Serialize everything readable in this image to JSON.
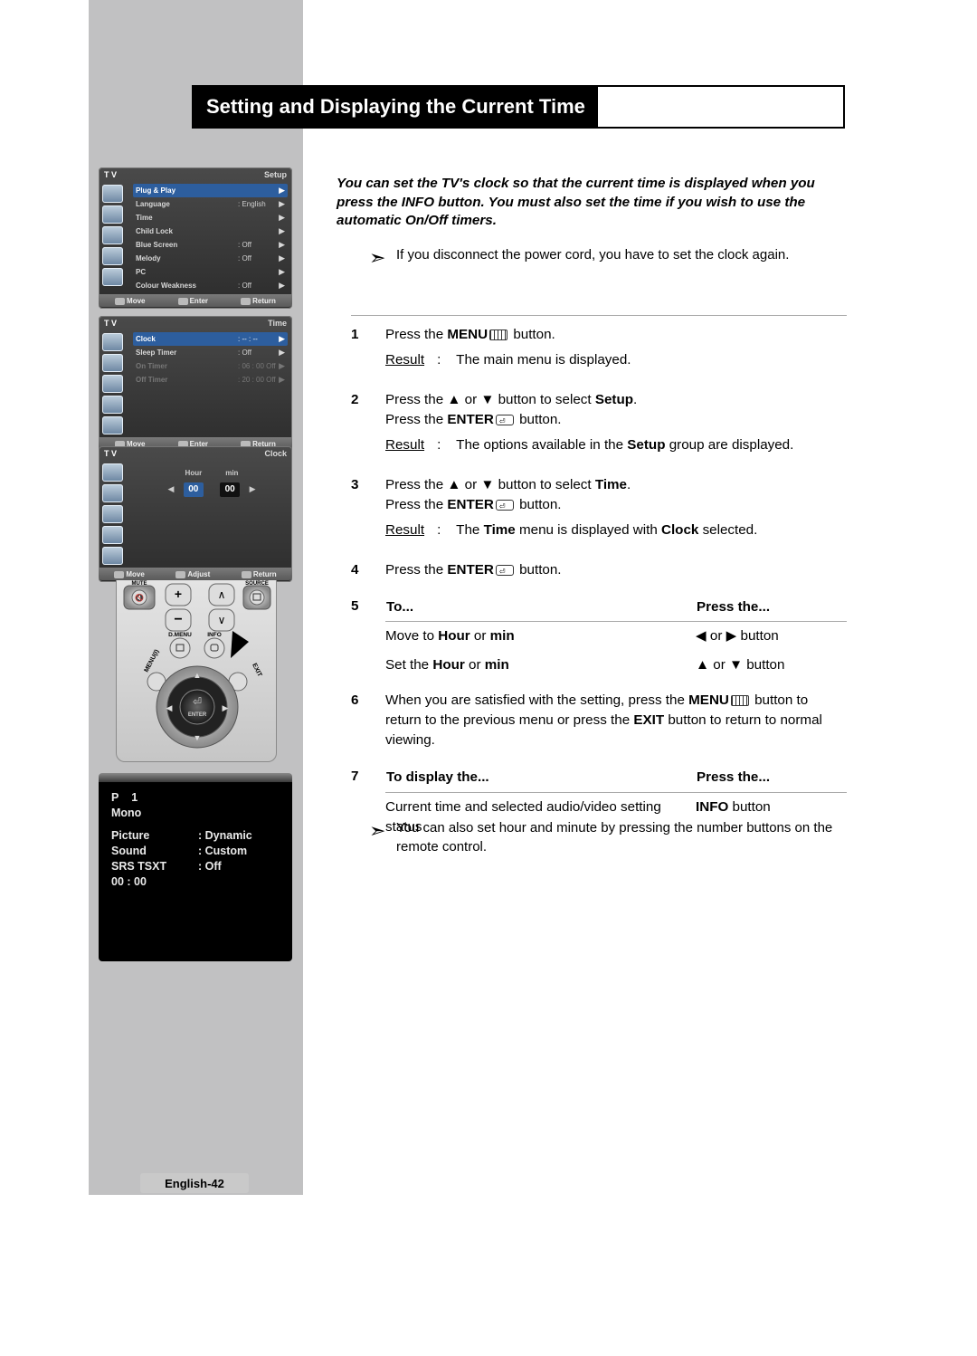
{
  "page_title": "Setting and Displaying the Current Time",
  "intro": "You can set the TV's clock so that the current time is displayed when you press the INFO button. You must also set the time if you wish to use the automatic On/Off timers.",
  "tip_disconnect": "If you disconnect the power cord, you have to set the clock again.",
  "steps": {
    "1": {
      "text_a": "Press the ",
      "menu_b": "MENU",
      "text_c": " button.",
      "result": "The main menu is displayed."
    },
    "2": {
      "line1_a": "Press the ▲ or ▼ button to select ",
      "line1_b": "Setup",
      "line1_c": ".",
      "line2_a": "Press the ",
      "line2_b": "ENTER",
      "line2_c": " button.",
      "result_a": "The options available in the ",
      "result_b": "Setup",
      "result_c": " group are displayed."
    },
    "3": {
      "line1_a": "Press the ▲ or ▼ button to select ",
      "line1_b": "Time",
      "line1_c": ".",
      "line2_a": "Press the ",
      "line2_b": "ENTER",
      "line2_c": " button.",
      "result_a": "The ",
      "result_b": "Time",
      "result_c": " menu is displayed with ",
      "result_d": "Clock",
      "result_e": " selected."
    },
    "4": {
      "a": "Press the ",
      "b": "ENTER",
      "c": " button."
    },
    "5": {
      "h_to": "To...",
      "h_press": "Press the...",
      "r1_a": "Move to ",
      "r1_b": "Hour",
      "r1_c": " or ",
      "r1_d": "min",
      "r1_v": "◀ or ▶ button",
      "r2_a": "Set the ",
      "r2_b": "Hour",
      "r2_c": " or ",
      "r2_d": "min",
      "r2_v": "▲ or ▼ button"
    },
    "6": {
      "a": "When you are satisfied with the setting, press the ",
      "b": "MENU",
      "c": " button to return to the previous menu or press the ",
      "d": "EXIT",
      "e": " button to return to normal viewing."
    },
    "7": {
      "h_to": "To display the...",
      "h_press": "Press the...",
      "r1_a": "Current time and selected audio/video setting status",
      "r1_v_a": "INFO",
      "r1_v_b": " button"
    }
  },
  "footnote": "You can also set hour and minute by pressing the number buttons on the remote control.",
  "result_label": "Result",
  "osd": {
    "tv_label": "T V",
    "setup": {
      "title": "Setup",
      "rows": [
        {
          "label": "Plug & Play",
          "val": "",
          "chev": "▶",
          "sel": true
        },
        {
          "label": "Language",
          "val": ": English",
          "chev": "▶"
        },
        {
          "label": "Time",
          "val": "",
          "chev": "▶"
        },
        {
          "label": "Child Lock",
          "val": "",
          "chev": "▶"
        },
        {
          "label": "Blue Screen",
          "val": ": Off",
          "chev": "▶"
        },
        {
          "label": "Melody",
          "val": ": Off",
          "chev": "▶"
        },
        {
          "label": "PC",
          "val": "",
          "chev": "▶"
        },
        {
          "label": "Colour Weakness",
          "val": ": Off",
          "chev": "▶"
        }
      ],
      "foot": [
        "Move",
        "Enter",
        "Return"
      ]
    },
    "time": {
      "title": "Time",
      "rows": [
        {
          "label": "Clock",
          "val": ":   -- : --",
          "chev": "▶",
          "sel": true
        },
        {
          "label": "Sleep Timer",
          "val": ":   Off",
          "chev": "▶"
        },
        {
          "label": "On Timer",
          "val": ":   06 : 00       Off",
          "chev": "▶",
          "dim": true
        },
        {
          "label": "Off Timer",
          "val": ":   20 : 00       Off",
          "chev": "▶",
          "dim": true
        }
      ],
      "foot": [
        "Move",
        "Enter",
        "Return"
      ]
    },
    "clock": {
      "title": "Clock",
      "h_hour": "Hour",
      "h_min": "min",
      "hour": "00",
      "min": "00",
      "foot": [
        "Move",
        "Adjust",
        "Return"
      ]
    }
  },
  "info_overlay": {
    "p": "P",
    "chan": "1",
    "mono": "Mono",
    "rows": [
      {
        "l": "Picture",
        "v": ": Dynamic"
      },
      {
        "l": "Sound",
        "v": ": Custom"
      },
      {
        "l": "SRS TSXT",
        "v": ": Off"
      },
      {
        "l": "00 : 00",
        "v": ""
      }
    ]
  },
  "remote_labels": {
    "mute": "MUTE",
    "source": "SOURCE",
    "dmenu": "D.MENU",
    "info": "INFO",
    "menui": "MENU(I)",
    "exit": "EXIT",
    "enter": "ENTER"
  },
  "pagefoot": "English-42"
}
